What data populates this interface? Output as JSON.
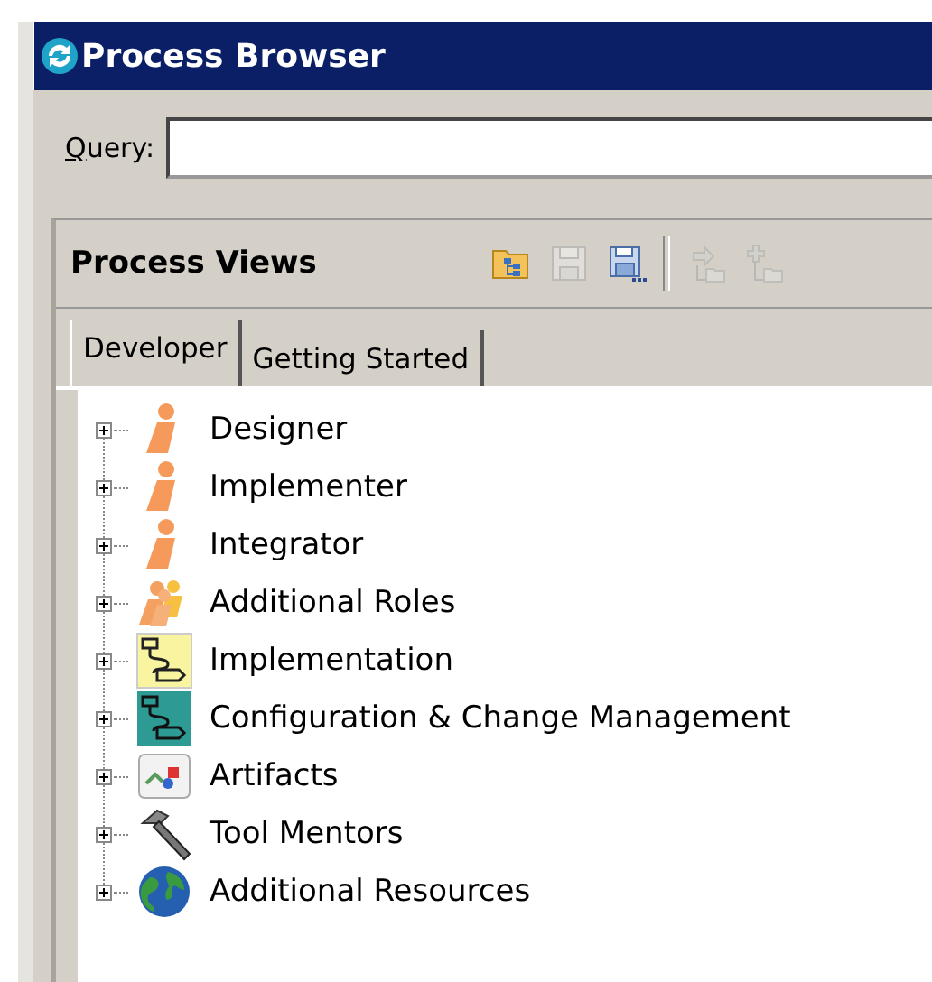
{
  "window": {
    "title": "Process Browser"
  },
  "query": {
    "label": "Query:"
  },
  "panel": {
    "title": "Process Views",
    "toolbar": [
      {
        "kind": "folder-tree",
        "disabled": false
      },
      {
        "kind": "save",
        "disabled": true
      },
      {
        "kind": "save-as",
        "disabled": false
      },
      {
        "kind": "separator"
      },
      {
        "kind": "move-node",
        "disabled": true
      },
      {
        "kind": "add-node",
        "disabled": true
      }
    ],
    "tabs": [
      {
        "label": "Developer",
        "selected": true
      },
      {
        "label": "Getting Started",
        "selected": false
      }
    ],
    "tree": [
      {
        "label": "Designer",
        "kind": "role",
        "expanded": false
      },
      {
        "label": "Implementer",
        "kind": "role",
        "expanded": false
      },
      {
        "label": "Integrator",
        "kind": "role",
        "expanded": false
      },
      {
        "label": "Additional Roles",
        "kind": "roles",
        "expanded": false
      },
      {
        "label": "Implementation",
        "kind": "workflow-yellow",
        "expanded": false
      },
      {
        "label": "Configuration & Change Management",
        "kind": "workflow-teal",
        "expanded": false
      },
      {
        "label": "Artifacts",
        "kind": "artifacts",
        "expanded": false
      },
      {
        "label": "Tool Mentors",
        "kind": "hammer",
        "expanded": false
      },
      {
        "label": "Additional Resources",
        "kind": "globe",
        "expanded": false
      }
    ]
  }
}
